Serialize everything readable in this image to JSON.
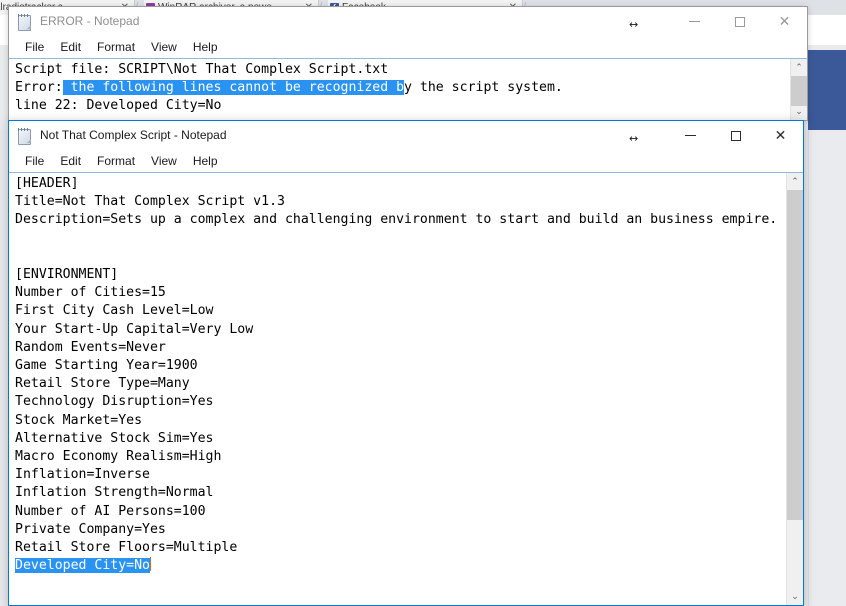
{
  "browser": {
    "tabs": [
      {
        "label": "igitalradiotracker.c",
        "favicon": "none",
        "close": "✕"
      },
      {
        "label": "WinRAR archiver, a powe",
        "favicon": "winrar-icon",
        "close": "✕"
      },
      {
        "label": "Facebook",
        "favicon": "facebook-icon",
        "favicon_letter": "f",
        "close": "✕"
      }
    ],
    "page_accent_color": "#3b5998",
    "page_background_color": "#e9ebee"
  },
  "windows": {
    "error": {
      "title": "ERROR - Notepad",
      "icon": "notepad-icon",
      "active": false,
      "cursor_glyph": "↔",
      "menu": [
        "File",
        "Edit",
        "Format",
        "View",
        "Help"
      ],
      "caption": {
        "minimize": "–",
        "maximize": "□",
        "close": "✕"
      },
      "text": {
        "before_selection": "Script file: SCRIPT\\Not That Complex Script.txt\nError:",
        "selection": " the following lines cannot be recognized b",
        "after_selection": "y the script system.\nline 22: Developed City=No"
      },
      "selection_color": "#2a92f0"
    },
    "script": {
      "title": "Not That Complex Script - Notepad",
      "icon": "notepad-icon",
      "active": true,
      "cursor_glyph": "↔",
      "menu": [
        "File",
        "Edit",
        "Format",
        "View",
        "Help"
      ],
      "caption": {
        "minimize": "–",
        "maximize": "□",
        "close": "✕"
      },
      "text": {
        "before_selection": "[HEADER]\nTitle=Not That Complex Script v1.3\nDescription=Sets up a complex and challenging environment to start and build an business empire.\n\n\n[ENVIRONMENT]\nNumber of Cities=15\nFirst City Cash Level=Low\nYour Start-Up Capital=Very Low\nRandom Events=Never\nGame Starting Year=1900\nRetail Store Type=Many\nTechnology Disruption=Yes\nStock Market=Yes\nAlternative Stock Sim=Yes\nMacro Economy Realism=High\nInflation=Inverse\nInflation Strength=Normal\nNumber of AI Persons=100\nPrivate Company=Yes\nRetail Store Floors=Multiple\n",
        "selection": "Developed City=No",
        "after_selection": ""
      },
      "selection_color": "#2a92f0",
      "caret_color": "#c8731a"
    }
  },
  "scrollbars": {
    "arrow_up": "⌃",
    "arrow_down": "⌄"
  }
}
